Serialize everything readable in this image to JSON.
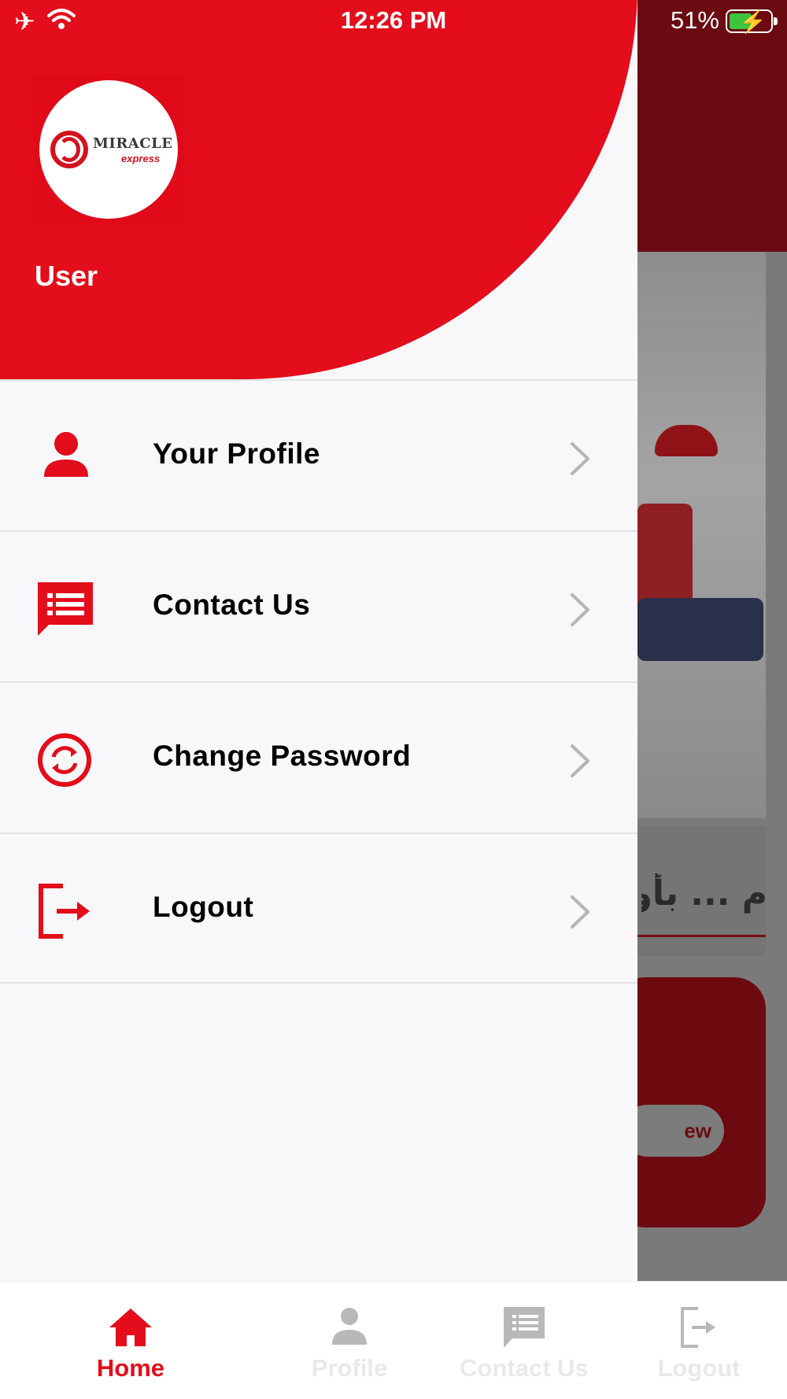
{
  "status_bar": {
    "time": "12:26 PM",
    "battery_percent": "51%",
    "icons": [
      "airplane-icon",
      "wifi-icon",
      "battery-charging-icon"
    ]
  },
  "drawer": {
    "logo": {
      "brand": "MIRACLE",
      "tagline": "express"
    },
    "user_name": "User",
    "menu_items": [
      {
        "label": "Your Profile",
        "icon": "person-icon"
      },
      {
        "label": "Contact Us",
        "icon": "chat-list-icon"
      },
      {
        "label": "Change Password",
        "icon": "refresh-circle-icon"
      },
      {
        "label": "Logout",
        "icon": "logout-icon"
      }
    ]
  },
  "background": {
    "arabic_text": "م ... بأو",
    "button_text": "ew"
  },
  "tab_bar": {
    "tabs": [
      {
        "label": "Home",
        "icon": "home-icon",
        "active": true
      },
      {
        "label": "Profile",
        "icon": "person-icon",
        "active": false
      },
      {
        "label": "Contact Us",
        "icon": "chat-list-icon",
        "active": false
      },
      {
        "label": "Logout",
        "icon": "logout-icon",
        "active": false
      }
    ]
  },
  "colors": {
    "accent": "#e30d1b",
    "drawer_bg": "#f8f8fa",
    "dimmed_header": "#6b0a10",
    "inactive_tab": "#b8b8b8"
  }
}
